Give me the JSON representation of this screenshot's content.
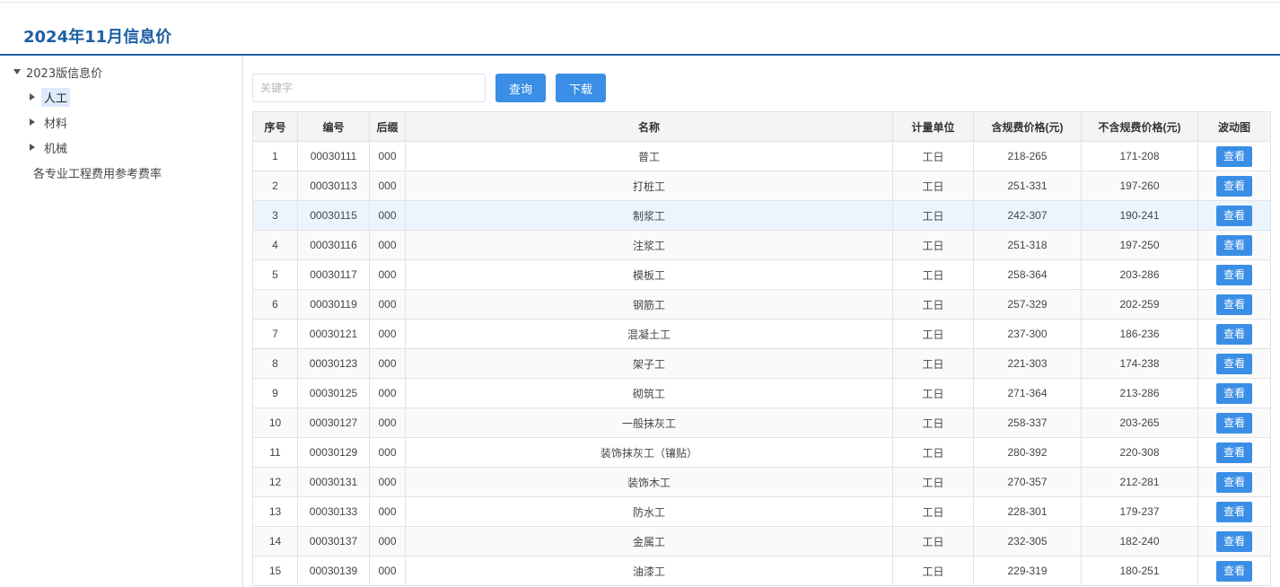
{
  "header": {
    "title": "2024年11月信息价"
  },
  "sidebar": {
    "root": "2023版信息价",
    "items": [
      {
        "label": "人工",
        "active": true
      },
      {
        "label": "材料",
        "active": false
      },
      {
        "label": "机械",
        "active": false
      }
    ],
    "extra": "各专业工程费用参考费率"
  },
  "search": {
    "placeholder": "关键字",
    "value": ""
  },
  "buttons": {
    "query": "查询",
    "download": "下载"
  },
  "table": {
    "columns": [
      "序号",
      "编号",
      "后缀",
      "名称",
      "计量单位",
      "含规费价格(元)",
      "不含规费价格(元)",
      "波动图"
    ],
    "view_label": "查看",
    "highlighted_row": 3,
    "rows": [
      [
        "1",
        "00030111",
        "000",
        "普工",
        "工日",
        "218-265",
        "171-208"
      ],
      [
        "2",
        "00030113",
        "000",
        "打桩工",
        "工日",
        "251-331",
        "197-260"
      ],
      [
        "3",
        "00030115",
        "000",
        "制浆工",
        "工日",
        "242-307",
        "190-241"
      ],
      [
        "4",
        "00030116",
        "000",
        "注浆工",
        "工日",
        "251-318",
        "197-250"
      ],
      [
        "5",
        "00030117",
        "000",
        "模板工",
        "工日",
        "258-364",
        "203-286"
      ],
      [
        "6",
        "00030119",
        "000",
        "钢筋工",
        "工日",
        "257-329",
        "202-259"
      ],
      [
        "7",
        "00030121",
        "000",
        "混凝土工",
        "工日",
        "237-300",
        "186-236"
      ],
      [
        "8",
        "00030123",
        "000",
        "架子工",
        "工日",
        "221-303",
        "174-238"
      ],
      [
        "9",
        "00030125",
        "000",
        "砌筑工",
        "工日",
        "271-364",
        "213-286"
      ],
      [
        "10",
        "00030127",
        "000",
        "一般抹灰工",
        "工日",
        "258-337",
        "203-265"
      ],
      [
        "11",
        "00030129",
        "000",
        "装饰抹灰工（镶贴）",
        "工日",
        "280-392",
        "220-308"
      ],
      [
        "12",
        "00030131",
        "000",
        "装饰木工",
        "工日",
        "270-357",
        "212-281"
      ],
      [
        "13",
        "00030133",
        "000",
        "防水工",
        "工日",
        "228-301",
        "179-237"
      ],
      [
        "14",
        "00030137",
        "000",
        "金属工",
        "工日",
        "232-305",
        "182-240"
      ],
      [
        "15",
        "00030139",
        "000",
        "油漆工",
        "工日",
        "229-319",
        "180-251"
      ]
    ]
  },
  "colors": {
    "accent": "#3a8ee6",
    "title": "#1c5fa4",
    "highlight": "#ecf5fd"
  }
}
